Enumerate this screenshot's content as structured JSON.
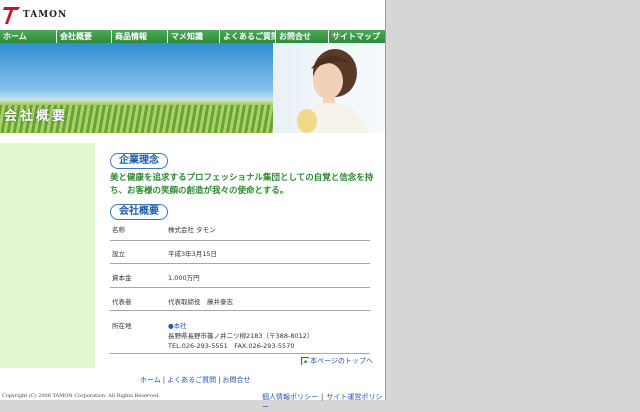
{
  "logo": {
    "text": "TAMON"
  },
  "nav": [
    "ホーム",
    "会社概要",
    "商品情報",
    "マメ知識",
    "よくあるご質問",
    "お問合せ",
    "サイトマップ"
  ],
  "hero": {
    "title": "会社概要"
  },
  "philosophy": {
    "heading": "企業理念",
    "text": "美と健康を追求するプロフェッショナル集団としての自覚と信念を持ち、お客様の笑顔の創造が我々の使命とする。"
  },
  "overview": {
    "heading": "会社概要",
    "rows": [
      {
        "key": "名称",
        "value": "株式会社 タモン"
      },
      {
        "key": "設立",
        "value": "平成3年3月15日"
      },
      {
        "key": "資本金",
        "value": "1,000万円"
      },
      {
        "key": "代表者",
        "value": "代表取締役　藤井泰志"
      },
      {
        "key": "所在地",
        "office": "●本社",
        "address": "長野県長野市篠ノ井二ツ柳2183（〒388-8012）",
        "phone": "TEL.026-293-5551　FAX.026-293-5570"
      }
    ]
  },
  "page_top": "本ページのトップへ",
  "footer_links": [
    "ホーム",
    "よくあるご質問",
    "お問合せ"
  ],
  "copyright": "Copyright (C) 2006 TAMON Corporation. All Rights Reserved.",
  "policy_links": [
    "個人情報ポリシー",
    "サイト運営ポリシー"
  ],
  "colors": {
    "nav_green": "#2e8a37",
    "badge_blue": "#3b78c2",
    "text_green": "#2e8a2e",
    "link_blue": "#2554b0",
    "logo_red": "#d0102a"
  }
}
